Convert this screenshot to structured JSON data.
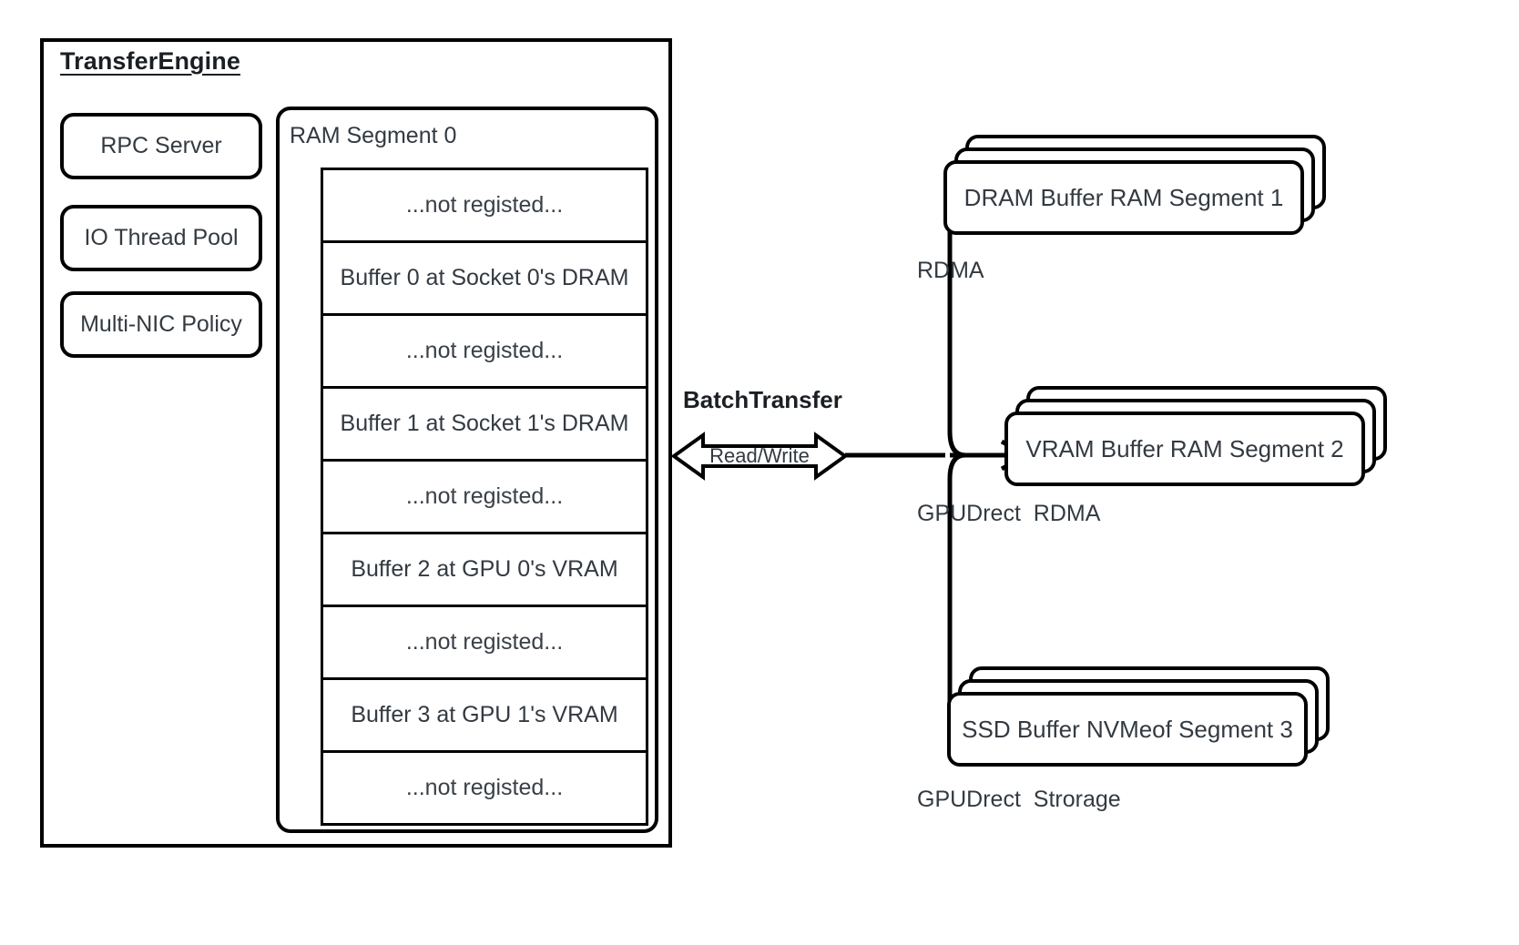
{
  "engine": {
    "title": "TransferEngine",
    "components": [
      {
        "label": "RPC Server"
      },
      {
        "label": "IO Thread Pool"
      },
      {
        "label": "Multi-NIC Policy"
      }
    ],
    "segment": {
      "title": "RAM Segment 0",
      "rows": [
        {
          "label": "...not registed...",
          "registered": false
        },
        {
          "label": "Buffer 0 at Socket 0's DRAM",
          "registered": true
        },
        {
          "label": "...not registed...",
          "registered": false
        },
        {
          "label": "Buffer 1 at Socket 1's DRAM",
          "registered": true
        },
        {
          "label": "...not registed...",
          "registered": false
        },
        {
          "label": "Buffer 2 at GPU 0's VRAM",
          "registered": true
        },
        {
          "label": "...not registed...",
          "registered": false
        },
        {
          "label": "Buffer 3 at GPU 1's VRAM",
          "registered": true
        },
        {
          "label": "...not registed...",
          "registered": false
        }
      ]
    }
  },
  "transfer": {
    "title": "BatchTransfer",
    "arrow_label": "Read/Write"
  },
  "targets": [
    {
      "label": "DRAM Buffer RAM Segment 1",
      "caption": "RDMA"
    },
    {
      "label": "VRAM Buffer RAM Segment 2",
      "caption": "GPUDrect  RDMA"
    },
    {
      "label": "SSD Buffer NVMeof Segment 3",
      "caption": "GPUDrect  Strorage"
    }
  ],
  "colors": {
    "stroke": "#000000",
    "text": "#333a41",
    "title": "#1b1f23",
    "background": "#ffffff"
  }
}
